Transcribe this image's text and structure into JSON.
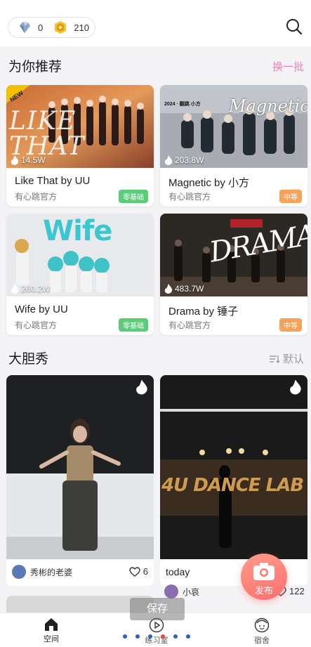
{
  "header": {
    "gem_count": "0",
    "coin_count": "210"
  },
  "recommend": {
    "title": "为你推荐",
    "refresh_label": "换一批",
    "items": [
      {
        "thumb_text": "LIKE THAT",
        "badge": "NEW",
        "plays": "14.5W",
        "title": "Like That by UU",
        "author": "有心跳官方",
        "level": "零基础",
        "level_color": "#5ccb7a"
      },
      {
        "thumb_text": "Magnetic",
        "thumb_sub": "2024 · 翻跳 小方",
        "plays": "203.8W",
        "title": "Magnetic by 小方",
        "author": "有心跳官方",
        "level": "中等",
        "level_color": "#f7a25b"
      },
      {
        "thumb_text": "Wife",
        "plays": "260.2W",
        "title": "Wife by UU",
        "author": "有心跳官方",
        "level": "零基础",
        "level_color": "#5ccb7a"
      },
      {
        "thumb_text": "DRAMA",
        "plays": "483.7W",
        "title": "Drama by 锤子",
        "author": "有心跳官方",
        "level": "中等",
        "level_color": "#f7a25b"
      }
    ]
  },
  "shows": {
    "title": "大胆秀",
    "sort_label": "默认",
    "items": [
      {
        "user": "秀彬的老婆",
        "likes": "6"
      },
      {
        "caption": "today",
        "thumb_text": "4U DANCE LAB",
        "user": "小哀",
        "likes": "122"
      }
    ]
  },
  "publish_label": "发布",
  "save_toast": "保存",
  "nav": {
    "space": "空间",
    "practice": "练习室",
    "dorm": "宿舍"
  },
  "colors": {
    "accent_pink": "#f080b8",
    "publish": "#ff7a72",
    "nav_active": "#222222"
  }
}
